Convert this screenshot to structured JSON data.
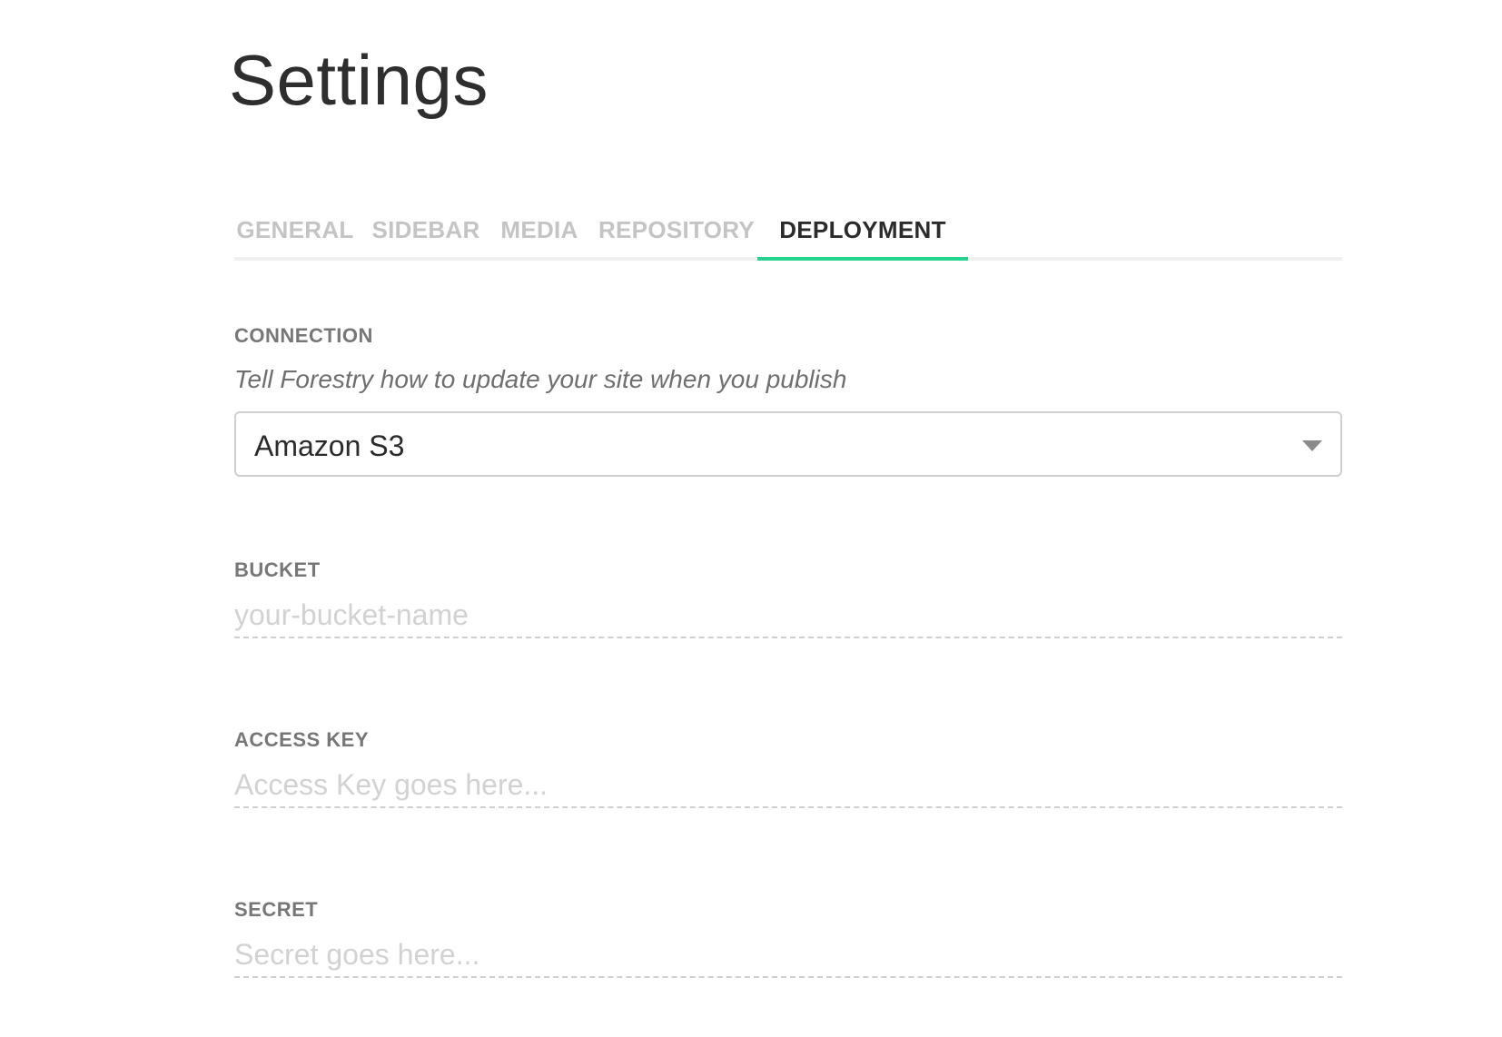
{
  "page": {
    "title": "Settings"
  },
  "tabs": [
    {
      "label": "GENERAL",
      "active": false
    },
    {
      "label": "SIDEBAR",
      "active": false
    },
    {
      "label": "MEDIA",
      "active": false
    },
    {
      "label": "REPOSITORY",
      "active": false
    },
    {
      "label": "DEPLOYMENT",
      "active": true
    }
  ],
  "connection": {
    "label": "CONNECTION",
    "description": "Tell Forestry how to update your site when you publish",
    "selected": "Amazon S3",
    "caret_icon": "chevron-down-icon"
  },
  "bucket": {
    "label": "BUCKET",
    "value": "",
    "placeholder": "your-bucket-name"
  },
  "access_key": {
    "label": "ACCESS KEY",
    "value": "",
    "placeholder": "Access Key goes here..."
  },
  "secret": {
    "label": "SECRET",
    "value": "",
    "placeholder": "Secret goes here..."
  },
  "colors": {
    "accent": "#24d28e",
    "tab_inactive": "#c4c4c4",
    "tab_active": "#2b2b2b",
    "label": "#777777",
    "placeholder": "#d2d2d2"
  }
}
